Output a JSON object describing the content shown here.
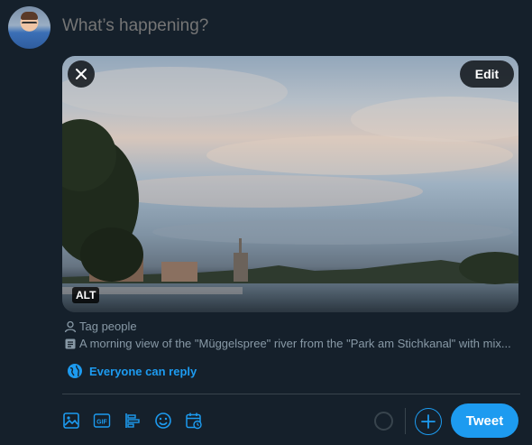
{
  "compose": {
    "placeholder": "What’s happening?"
  },
  "media": {
    "edit_label": "Edit",
    "alt_label": "ALT",
    "tag_people": "Tag people",
    "description": "A morning view of the \"Müggelspree\" river from the \"Park am Stichkanal\" with mix..."
  },
  "reply": {
    "label": "Everyone can reply"
  },
  "actions": {
    "tweet_label": "Tweet"
  },
  "icons": {
    "close": "close-icon",
    "edit": "edit",
    "tag": "person-icon",
    "description": "document-icon",
    "globe": "globe-icon",
    "toolbar": [
      "image-icon",
      "gif-icon",
      "poll-icon",
      "emoji-icon",
      "schedule-icon"
    ]
  },
  "colors": {
    "background": "#15202b",
    "accent": "#1d9bf0",
    "muted_text": "#8899a6",
    "divider": "#38444d"
  }
}
